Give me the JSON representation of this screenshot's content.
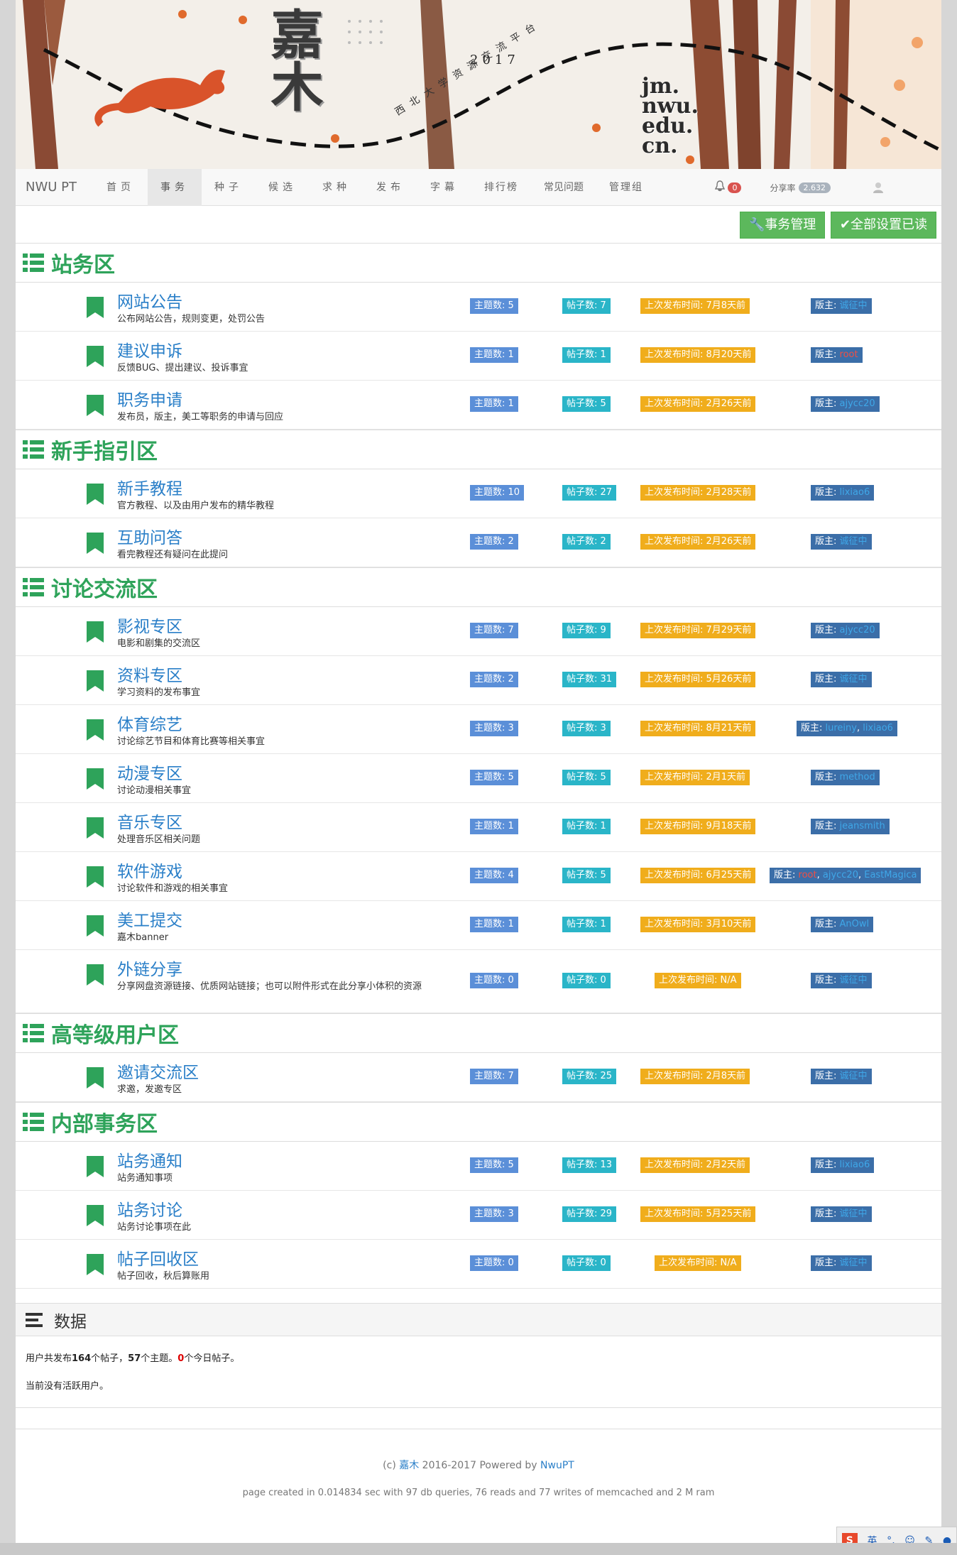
{
  "banner": {
    "calligraphy": "嘉木",
    "year": "2017",
    "slogan": "西北大学资源交流平台",
    "domain_lines": [
      "jm.",
      "nwu.",
      "edu.",
      "cn."
    ]
  },
  "nav": {
    "brand": "NWU PT",
    "items": [
      "首页",
      "事务",
      "种子",
      "候选",
      "求种",
      "发布",
      "字幕",
      "排行榜",
      "常见问题",
      "管理组"
    ],
    "active_index": 1,
    "notification_count": "0",
    "share_label": "分享率",
    "share_value": "2.632"
  },
  "toolbar": {
    "manage_label": "事务管理",
    "mark_read_label": "全部设置已读"
  },
  "labels": {
    "topics_prefix": "主题数: ",
    "posts_prefix": "帖子数: ",
    "time_prefix": "上次发布时间: ",
    "mod_prefix": "版主: "
  },
  "sections": [
    {
      "title": "站务区",
      "forums": [
        {
          "name": "网站公告",
          "desc": "公布网站公告，规则变更，处罚公告",
          "topics": "5",
          "posts": "7",
          "time": "7月8天前",
          "mods": [
            {
              "n": "诚征中",
              "c": "m"
            }
          ]
        },
        {
          "name": "建议申诉",
          "desc": "反馈BUG、提出建议、投诉事宜",
          "topics": "1",
          "posts": "1",
          "time": "8月20天前",
          "mods": [
            {
              "n": "root",
              "c": "r"
            }
          ]
        },
        {
          "name": "职务申请",
          "desc": "发布员，版主，美工等职务的申请与回应",
          "topics": "1",
          "posts": "5",
          "time": "2月26天前",
          "mods": [
            {
              "n": "ajycc20",
              "c": "m"
            }
          ]
        }
      ]
    },
    {
      "title": "新手指引区",
      "forums": [
        {
          "name": "新手教程",
          "desc": "官方教程、以及由用户发布的精华教程",
          "topics": "10",
          "posts": "27",
          "time": "2月28天前",
          "mods": [
            {
              "n": "lixiao6",
              "c": "m"
            }
          ]
        },
        {
          "name": "互助问答",
          "desc": "看完教程还有疑问在此提问",
          "topics": "2",
          "posts": "2",
          "time": "2月26天前",
          "mods": [
            {
              "n": "诚征中",
              "c": "m"
            }
          ]
        }
      ]
    },
    {
      "title": "讨论交流区",
      "forums": [
        {
          "name": "影视专区",
          "desc": "电影和剧集的交流区",
          "topics": "7",
          "posts": "9",
          "time": "7月29天前",
          "mods": [
            {
              "n": "ajycc20",
              "c": "m"
            }
          ]
        },
        {
          "name": "资料专区",
          "desc": "学习资料的发布事宜",
          "topics": "2",
          "posts": "31",
          "time": "5月26天前",
          "mods": [
            {
              "n": "诚征中",
              "c": "m"
            }
          ]
        },
        {
          "name": "体育综艺",
          "desc": "讨论综艺节目和体育比赛等相关事宜",
          "topics": "3",
          "posts": "3",
          "time": "8月21天前",
          "mods": [
            {
              "n": "lureiny",
              "c": "m"
            },
            {
              "n": "lixiao6",
              "c": "m"
            }
          ]
        },
        {
          "name": "动漫专区",
          "desc": "讨论动漫相关事宜",
          "topics": "5",
          "posts": "5",
          "time": "2月1天前",
          "mods": [
            {
              "n": "method",
              "c": "m"
            }
          ]
        },
        {
          "name": "音乐专区",
          "desc": "处理音乐区相关问题",
          "topics": "1",
          "posts": "1",
          "time": "9月18天前",
          "mods": [
            {
              "n": "jeansmith",
              "c": "m"
            }
          ]
        },
        {
          "name": "软件游戏",
          "desc": "讨论软件和游戏的相关事宜",
          "topics": "4",
          "posts": "5",
          "time": "6月25天前",
          "mods": [
            {
              "n": "root",
              "c": "r"
            },
            {
              "n": "ajycc20",
              "c": "m"
            },
            {
              "n": "EastMagica",
              "c": "m"
            }
          ]
        },
        {
          "name": "美工提交",
          "desc": "嘉木banner",
          "topics": "1",
          "posts": "1",
          "time": "3月10天前",
          "mods": [
            {
              "n": "AnOwl",
              "c": "m"
            }
          ]
        },
        {
          "name": "外链分享",
          "desc": "分享网盘资源链接、优质网站链接；也可以附件形式在此分享小体积的资源",
          "topics": "0",
          "posts": "0",
          "time": "N/A",
          "mods": [
            {
              "n": "诚征中",
              "c": "m"
            }
          ],
          "tall": true
        }
      ]
    },
    {
      "title": "高等级用户区",
      "forums": [
        {
          "name": "邀请交流区",
          "desc": "求邀，发邀专区",
          "topics": "7",
          "posts": "25",
          "time": "2月8天前",
          "mods": [
            {
              "n": "诚征中",
              "c": "m"
            }
          ]
        }
      ]
    },
    {
      "title": "内部事务区",
      "forums": [
        {
          "name": "站务通知",
          "desc": "站务通知事项",
          "topics": "5",
          "posts": "13",
          "time": "2月2天前",
          "mods": [
            {
              "n": "lixiao6",
              "c": "m"
            }
          ]
        },
        {
          "name": "站务讨论",
          "desc": "站务讨论事项在此",
          "topics": "3",
          "posts": "29",
          "time": "5月25天前",
          "mods": [
            {
              "n": "诚征中",
              "c": "m"
            }
          ]
        },
        {
          "name": "帖子回收区",
          "desc": "帖子回收，秋后算账用",
          "topics": "0",
          "posts": "0",
          "time": "N/A",
          "mods": [
            {
              "n": "诚征中",
              "c": "m"
            }
          ]
        }
      ]
    }
  ],
  "stats": {
    "title": "数据",
    "line1_a": "用户共发布",
    "posts_total": "164",
    "line1_b": "个帖子，",
    "topics_total": "57",
    "line1_c": "个主题。",
    "today_posts": "0",
    "line1_d": "个今日帖子。",
    "line2": "当前没有活跃用户。"
  },
  "footer": {
    "copy_prefix": "(c) ",
    "site_name": "嘉木",
    "copy_mid": " 2016-2017 Powered by ",
    "engine": "NwuPT",
    "page_created": "page created in 0.014834 sec with 97 db queries, 76 reads and 77 writes of memcached and 2 M ram"
  },
  "ime": {
    "mode": "英"
  },
  "colors": {
    "section_green": "#2ea35a",
    "link_blue": "#2a7fc8",
    "topic_blue": "#5b8fd8",
    "post_teal": "#2ab5c8",
    "time_orange": "#f0ad1c",
    "mod_navy": "#3b6ea8",
    "button_green": "#5cb85c"
  }
}
